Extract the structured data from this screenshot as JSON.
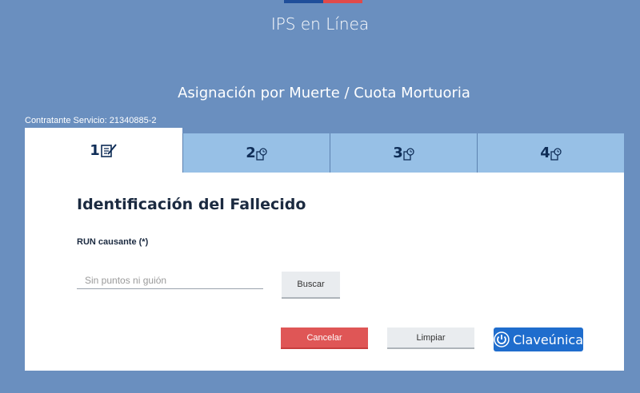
{
  "header": {
    "app_title": "IPS en Línea",
    "page_title": "Asignación por Muerte / Cuota Mortuoria",
    "contract_line": "Contratante Servicio: 21340885-2"
  },
  "steps": [
    {
      "number": "1",
      "icon": "checklist-icon",
      "active": true
    },
    {
      "number": "2",
      "icon": "document-clock-icon",
      "active": false
    },
    {
      "number": "3",
      "icon": "document-clock-icon",
      "active": false
    },
    {
      "number": "4",
      "icon": "document-clock-icon",
      "active": false
    }
  ],
  "form": {
    "heading": "Identificación del Fallecido",
    "run_label": "RUN causante (*)",
    "run_placeholder": "Sin puntos ni guión",
    "run_value": "",
    "search_label": "Buscar"
  },
  "actions": {
    "cancel_label": "Cancelar",
    "clear_label": "Limpiar",
    "clave_label": "Claveúnica"
  },
  "colors": {
    "background": "#6a8fbf",
    "step_inactive": "#97c0e6",
    "cancel": "#df5656",
    "clave": "#1f6dcd"
  }
}
